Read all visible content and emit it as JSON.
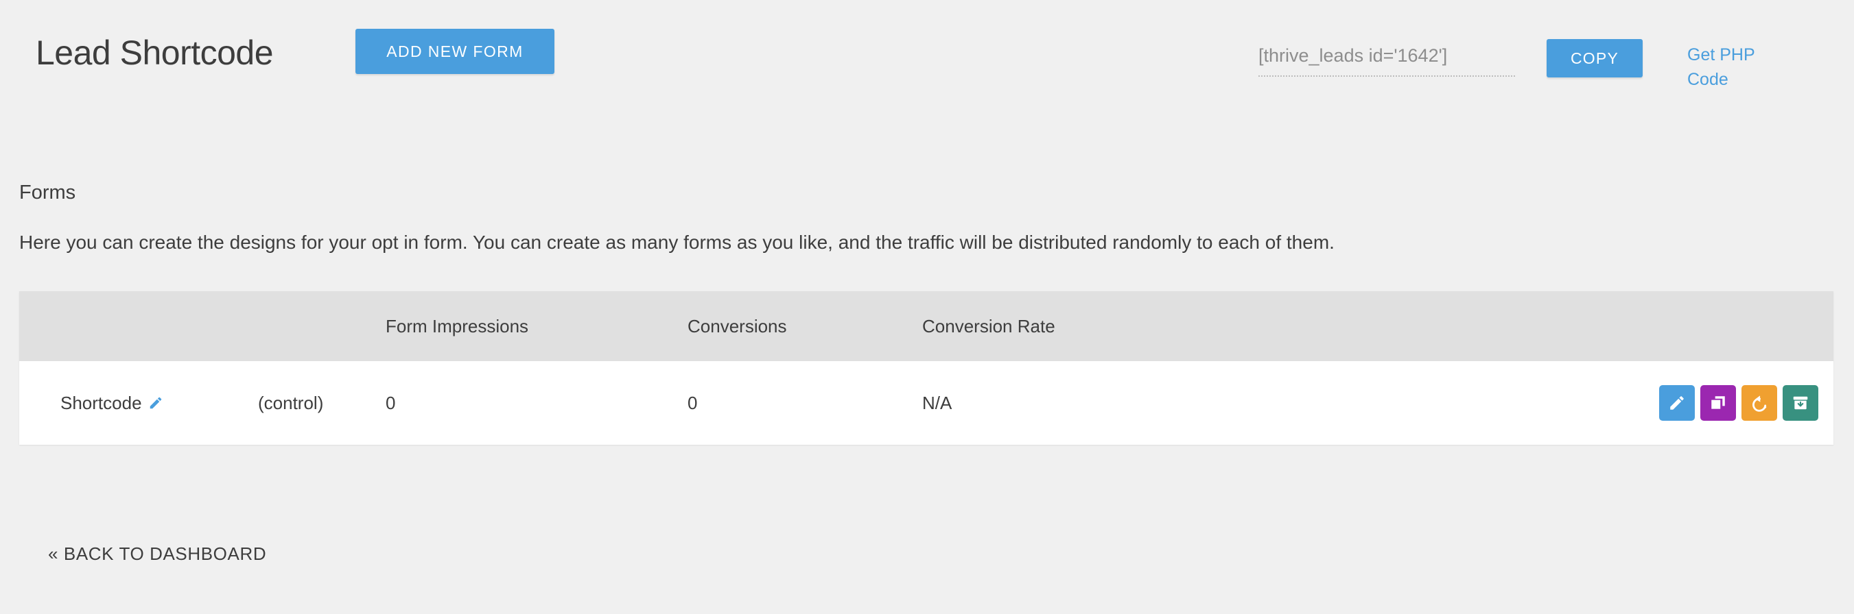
{
  "header": {
    "title": "Lead Shortcode",
    "add_new_form_label": "ADD NEW FORM",
    "shortcode_value": "[thrive_leads id='1642']",
    "shortcode_placeholder": "[thrive_leads id='1642']",
    "copy_label": "COPY",
    "get_php_code_label": "Get PHP Code"
  },
  "forms_section": {
    "heading": "Forms",
    "description": "Here you can create the designs for your opt in form. You can create as many forms as you like, and the traffic will be distributed randomly to each of them."
  },
  "table": {
    "columns": [
      "",
      "",
      "Form Impressions",
      "Conversions",
      "Conversion Rate",
      ""
    ],
    "headers": {
      "name": "",
      "variation": "",
      "impressions": "Form Impressions",
      "conversions": "Conversions",
      "conversion_rate": "Conversion Rate",
      "actions": ""
    },
    "rows": [
      {
        "name": "Shortcode",
        "variation": "(control)",
        "impressions": "0",
        "conversions": "0",
        "conversion_rate": "N/A",
        "actions": [
          {
            "name": "edit",
            "icon": "pencil-icon",
            "color": "#4a9edd"
          },
          {
            "name": "duplicate",
            "icon": "duplicate-icon",
            "color": "#9b27b0"
          },
          {
            "name": "reset",
            "icon": "undo-arrow-icon",
            "color": "#f0a030"
          },
          {
            "name": "archive",
            "icon": "archive-box-icon",
            "color": "#389180"
          }
        ]
      }
    ]
  },
  "footer": {
    "back_label": "« BACK TO DASHBOARD"
  },
  "colors": {
    "page_background": "#f0f0f0",
    "accent_blue": "#4a9edd",
    "table_header_background": "#e0e0e0",
    "table_row_background": "#ffffff",
    "text_primary": "#3d3d3d",
    "text_muted": "#8d8d8d",
    "action_edit": "#4a9edd",
    "action_duplicate": "#9b27b0",
    "action_reset": "#f0a030",
    "action_archive": "#389180"
  }
}
